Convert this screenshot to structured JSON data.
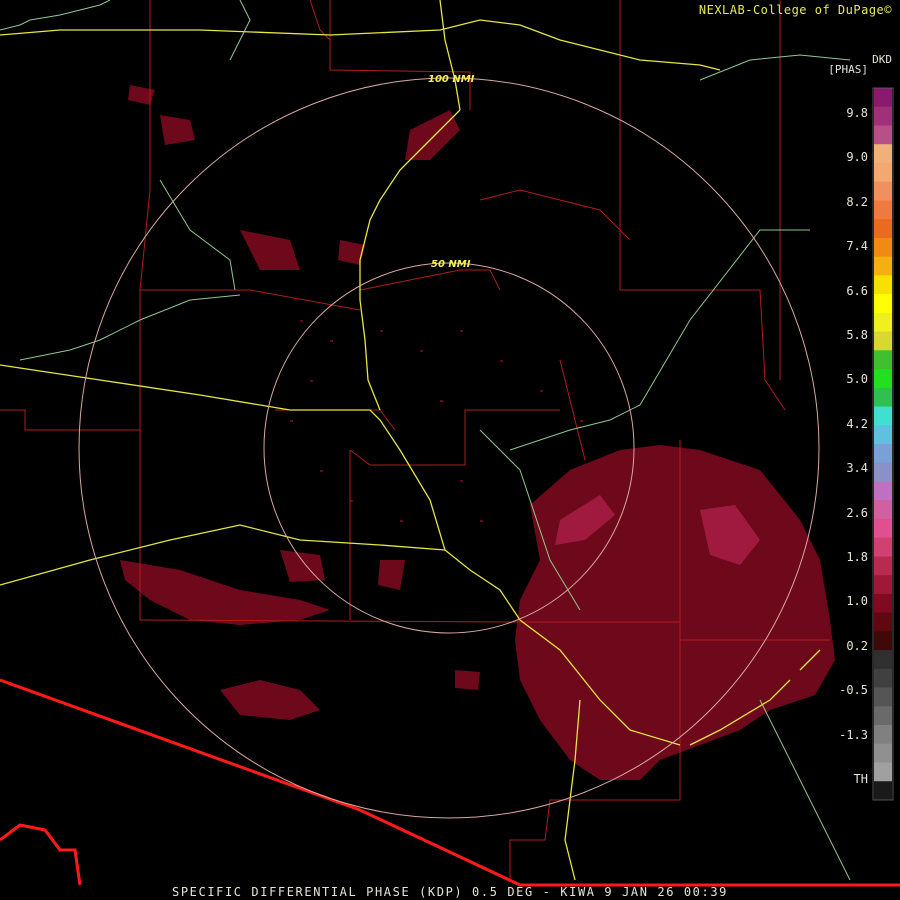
{
  "header": {
    "credit": "NEXLAB-College of DuPage©"
  },
  "footer": {
    "caption": "SPECIFIC DIFFERENTIAL PHASE (KDP) 0.5 DEG - KIWA 9 JAN 26 00:39"
  },
  "legend": {
    "unit_line1": "DKD",
    "unit_line2": "[PHAS]",
    "labels": [
      "9.8",
      "9.0",
      "8.2",
      "7.4",
      "6.6",
      "5.8",
      "5.0",
      "4.2",
      "3.4",
      "2.6",
      "1.8",
      "1.0",
      "0.2",
      "-0.5",
      "-1.3",
      "TH"
    ],
    "colors": [
      "#8a1a6e",
      "#a0307a",
      "#b85088",
      "#f0b07a",
      "#f2a870",
      "#f09060",
      "#ee7a40",
      "#ec6a20",
      "#f08a10",
      "#f4b010",
      "#f8e000",
      "#ffff00",
      "#f0f020",
      "#d8d830",
      "#40c030",
      "#20e020",
      "#30c050",
      "#40e0d0",
      "#60c0e0",
      "#7aa0d8",
      "#8a90c8",
      "#c070c0",
      "#d060a0",
      "#e05090",
      "#d04070",
      "#b82a50",
      "#a01838",
      "#800a20",
      "#600810",
      "#400808",
      "#303030",
      "#404040",
      "#555555",
      "#6a6a6a",
      "#808080",
      "#909090",
      "#a0a0a0",
      "#1a1a1a"
    ]
  },
  "rings": {
    "inner_label": "50 NMI",
    "outer_label": "100 NMI"
  },
  "colors": {
    "county_line": "#b01c1c",
    "state_line": "#ff1a1a",
    "highway": "#e6e640",
    "river": "#8fc88f",
    "range_ring": "#d8a8a0",
    "echo": "#7a0a1e",
    "echo_light": "#a01a40"
  }
}
